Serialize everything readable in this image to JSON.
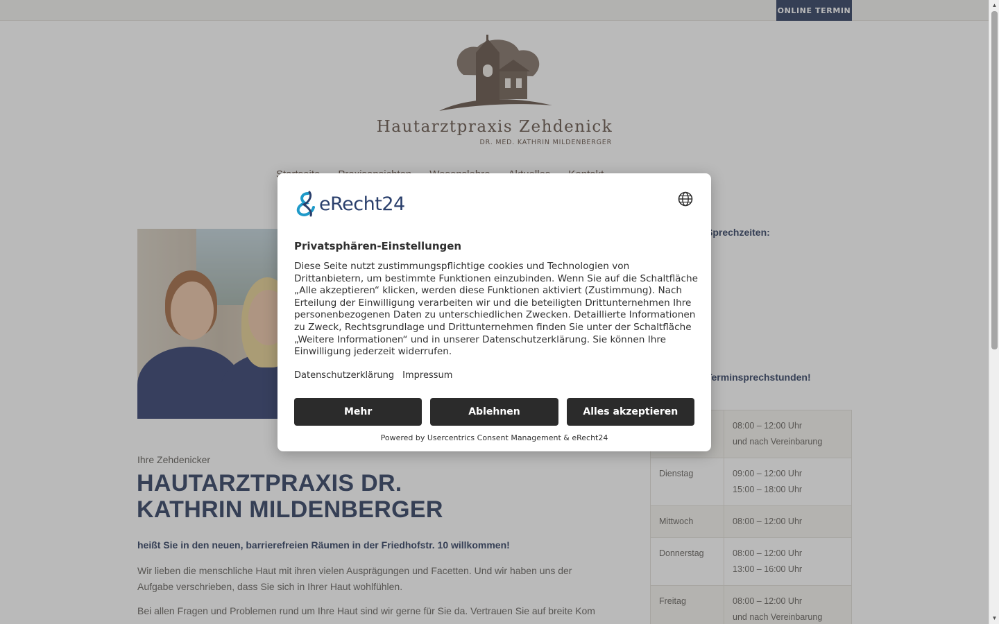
{
  "topbar": {
    "online_button": "ONLINE TERMIN"
  },
  "logo": {
    "name": "Hautarztpraxis Zehdenick",
    "subtitle": "DR. MED. KATHRIN MILDENBERGER"
  },
  "nav": {
    "items": [
      {
        "label": "Startseite"
      },
      {
        "label": "Praxisansichten"
      },
      {
        "label": "Wesenslehre"
      },
      {
        "label": "Aktuelles"
      },
      {
        "label": "Kontakt"
      }
    ]
  },
  "sidebar": {
    "heading_hours": "Sprechzeiten:",
    "heading_appointments": "Terminsprechstunden!",
    "hours_rows": [
      {
        "day": "",
        "line1": "08:00 – 12:00 Uhr",
        "line2": "und nach Vereinbarung"
      },
      {
        "day": "Dienstag",
        "line1": "09:00 – 12:00 Uhr",
        "line2": "15:00 – 18:00 Uhr"
      },
      {
        "day": "Mittwoch",
        "line1": "08:00 – 12:00 Uhr",
        "line2": ""
      },
      {
        "day": "Donnerstag",
        "line1": "08:00 – 12:00 Uhr",
        "line2": "13:00 – 16:00 Uhr"
      },
      {
        "day": "Freitag",
        "line1": "08:00 – 12:00 Uhr",
        "line2": "und nach Vereinbarung"
      }
    ]
  },
  "intro": {
    "small": "Ihre Zehdenicker",
    "title": "HAUTARZTPRAXIS DR. KATHRIN MILDENBERGER",
    "bold": "heißt Sie in den neuen, barrierefreien Räumen in der Friedhofstr. 10 willkommen!",
    "p1": "Wir lieben die menschliche Haut mit ihren vielen Ausprägungen und Facetten. Und wir haben uns der Aufgabe verschrieben, dass Sie sich in Ihrer Haut wohlfühlen.",
    "p2": "Bei allen Fragen und Problemen rund um Ihre Haut sind wir gerne für Sie da. Vertrauen Sie auf breite Kompetenz"
  },
  "consent": {
    "brand": "eRecht24",
    "title": "Privatsphären-Einstellungen",
    "body": "Diese Seite nutzt zustimmungspflichtige cookies und Technologien von Drittanbietern, um bestimmte Funktionen einzubinden. Wenn Sie auf die Schaltfläche „Alle akzeptieren“ klicken, werden diese Funktionen aktiviert (Zustimmung). Nach Erteilung der Einwilligung verarbeiten wir und die beteiligten Drittunternehmen Ihre personenbezogenen Daten zu unterschiedlichen Zwecken. Detaillierte Informationen zu Zweck, Rechtsgrundlage und Drittunternehmen finden Sie unter der Schaltfläche „Weitere Informationen“ und in unserer Datenschutzerklärung. Sie können Ihre Einwilligung jederzeit widerrufen.",
    "link_privacy": "Datenschutzerklärung",
    "link_imprint": "Impressum",
    "btn_more": "Mehr",
    "btn_decline": "Ablehnen",
    "btn_accept": "Alles akzeptieren",
    "powered": "Powered by Usercentrics Consent Management & eRecht24"
  },
  "colors": {
    "accent": "#3b4a6b",
    "logo_brown": "#6d5d53",
    "dialog_button": "#2b2b2b"
  },
  "icons": {
    "language": "globe-icon",
    "brand_mark": "erecht24-logo-icon"
  }
}
